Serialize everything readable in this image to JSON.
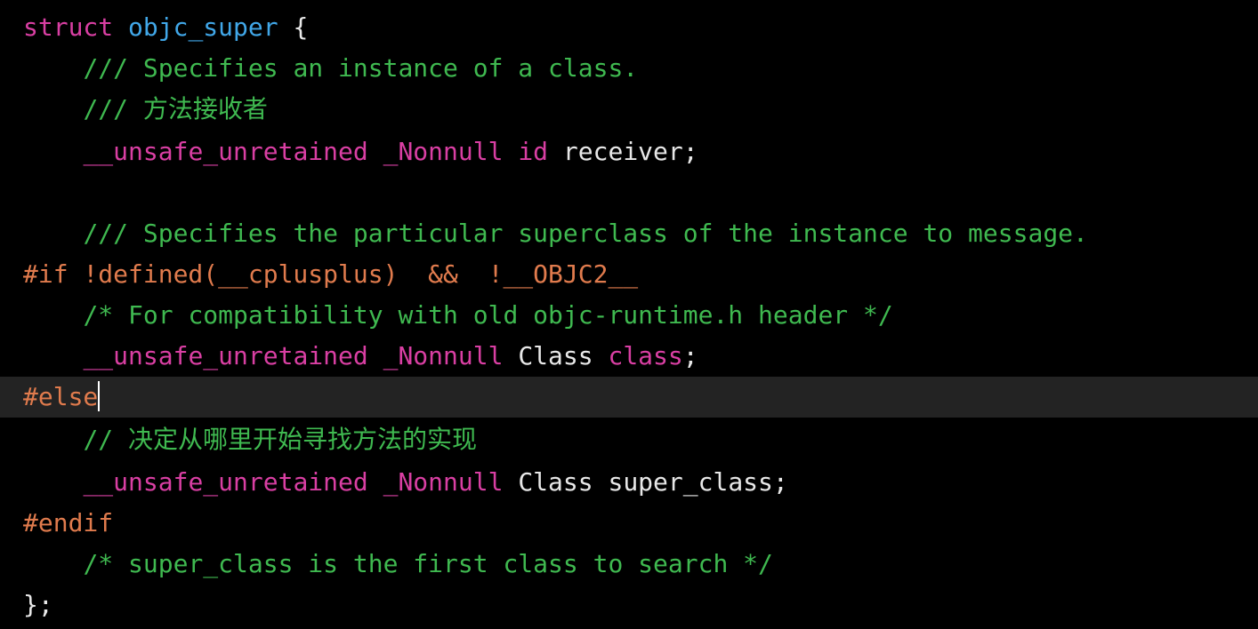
{
  "colors": {
    "background": "#000000",
    "current_line": "#232323",
    "keyword": "#d93fa3",
    "identifier": "#41a7e8",
    "comment": "#3fb950",
    "preprocessor": "#e07b4d",
    "plain": "#e8e8e8"
  },
  "code": {
    "l1": {
      "kw": "struct",
      "name": "objc_super",
      "brace": "{"
    },
    "l2": {
      "comment": "/// Specifies an instance of a class."
    },
    "l3": {
      "comment": "/// 方法接收者"
    },
    "l4": {
      "q1": "__unsafe_unretained",
      "q2": "_Nonnull",
      "type": "id",
      "name": "receiver;"
    },
    "l6": {
      "comment": "/// Specifies the particular superclass of the instance to message."
    },
    "l7": {
      "prep": "#if !defined(__cplusplus)  &&  !__OBJC2__"
    },
    "l8": {
      "comment": "/* For compatibility with old objc-runtime.h header */"
    },
    "l9": {
      "q1": "__unsafe_unretained",
      "q2": "_Nonnull",
      "type": "Class",
      "name": "class",
      "semi": ";"
    },
    "l10": {
      "prep": "#else"
    },
    "l11": {
      "comment": "// 决定从哪里开始寻找方法的实现"
    },
    "l12": {
      "q1": "__unsafe_unretained",
      "q2": "_Nonnull",
      "type": "Class",
      "name": "super_class;"
    },
    "l13": {
      "prep": "#endif"
    },
    "l14": {
      "comment": "/* super_class is the first class to search */"
    },
    "l15": {
      "close": "};"
    }
  }
}
